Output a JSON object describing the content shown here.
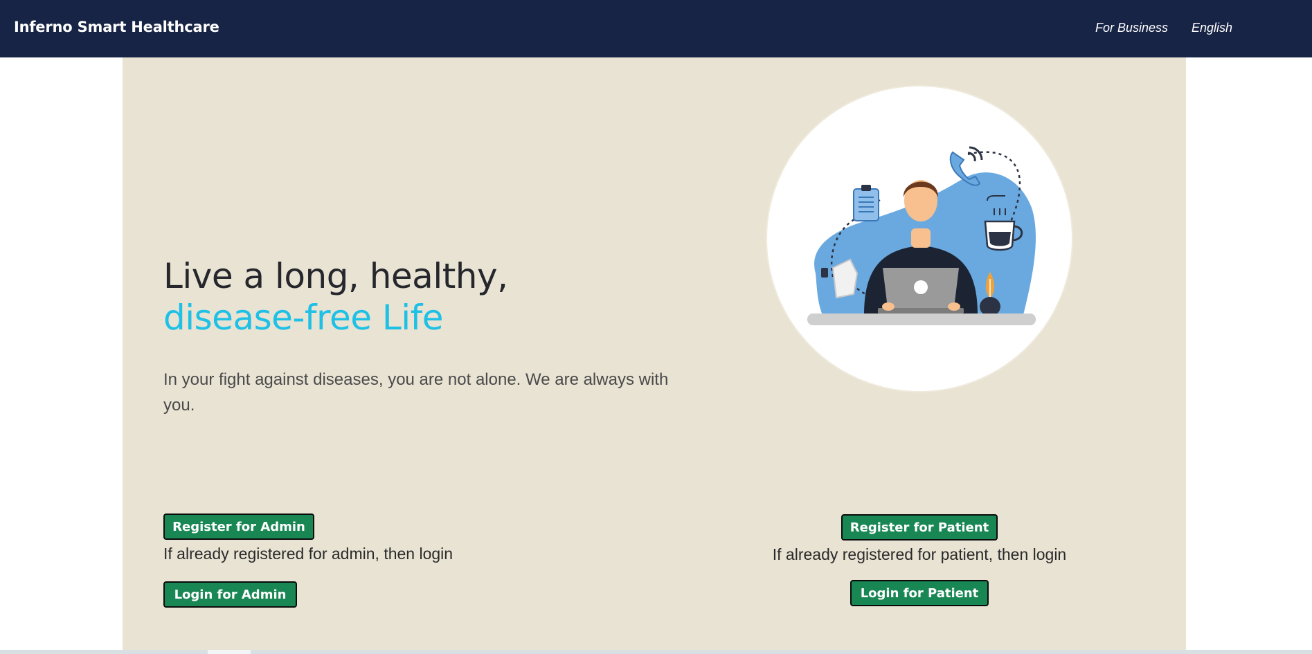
{
  "navbar": {
    "brand": "Inferno Smart Healthcare",
    "links": [
      "For Business",
      "English"
    ]
  },
  "hero": {
    "headline_part1": "Live a long, healthy, ",
    "headline_accent": "disease-free Life",
    "subtitle": "In your fight against diseases, you are not alone. We are always with you.",
    "illustration": "doctor-at-laptop-illustration"
  },
  "admin": {
    "register_label": "Register for Admin",
    "note": "If already registered for admin, then login",
    "login_label": "Login for Admin"
  },
  "patient": {
    "register_label": "Register for Patient",
    "note": "If already registered for patient, then login",
    "login_label": "Login for Patient"
  },
  "colors": {
    "navbar": "#172445",
    "hero_bg": "#e8e3d3",
    "accent": "#1ec0e6",
    "button": "#198754"
  }
}
